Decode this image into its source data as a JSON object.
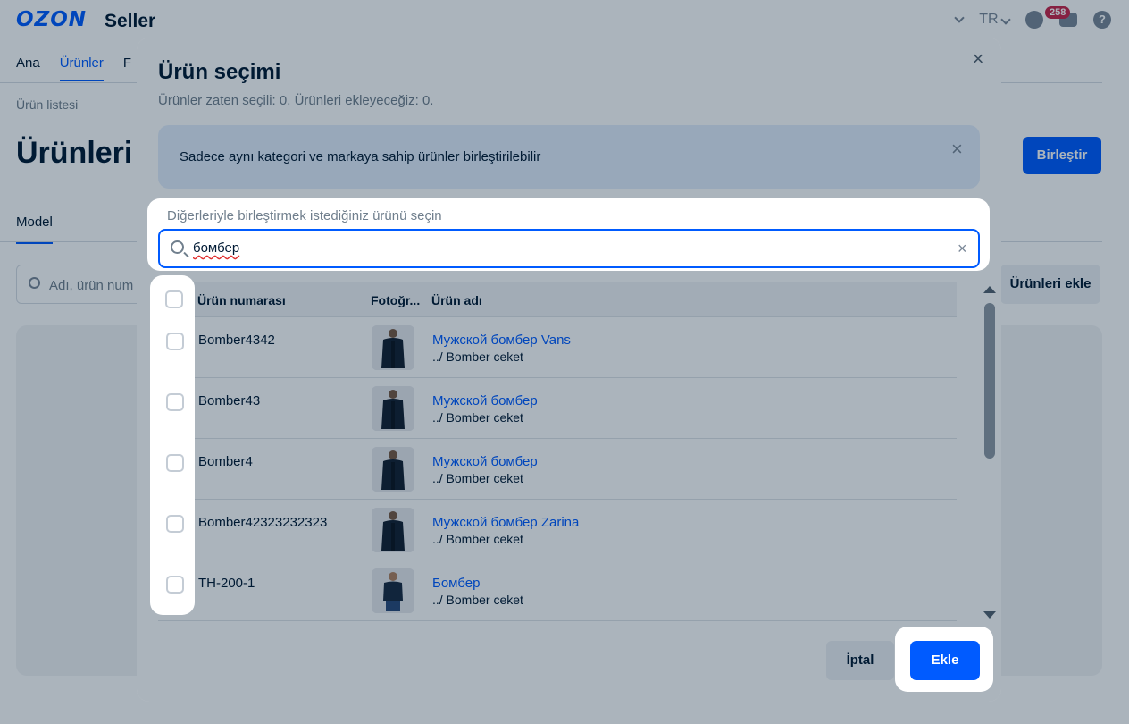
{
  "app": {
    "logo": "OZON",
    "logo_suffix": "Seller",
    "language": "TR",
    "notification_count": "258"
  },
  "nav": {
    "tabs": [
      {
        "label": "Ana"
      },
      {
        "label": "Ürünler"
      },
      {
        "label": "F"
      }
    ]
  },
  "page": {
    "breadcrumb": "Ürün listesi",
    "title": "Ürünleri b",
    "merge_button": "Birleştir",
    "model_tab": "Model",
    "search_placeholder": "Adı, ürün num",
    "add_products_button": "Ürünleri ekle"
  },
  "modal": {
    "title": "Ürün seçimi",
    "subtitle": "Ürünler zaten seçili: 0. Ürünleri ekleyeceğiz: 0.",
    "notice": "Sadece aynı kategori ve markaya sahip ürünler birleştirilebilir",
    "search_label": "Diğerleriyle birleştirmek istediğiniz ürünü seçin",
    "search_value": "бомбер",
    "columns": {
      "sku": "Ürün numarası",
      "photo": "Fotoğr...",
      "name": "Ürün adı"
    },
    "rows": [
      {
        "sku": "Bomber4342",
        "name": "Мужской бомбер Vans",
        "category": "../ Bomber ceket"
      },
      {
        "sku": "Bomber43",
        "name": "Мужской бомбер",
        "category": "../ Bomber ceket"
      },
      {
        "sku": "Bomber4",
        "name": "Мужской бомбер",
        "category": "../ Bomber ceket"
      },
      {
        "sku": "Bomber42323232323",
        "name": "Мужской бомбер Zarina",
        "category": "../ Bomber ceket"
      },
      {
        "sku": "TH-200-1",
        "name": "Бомбер",
        "category": "../ Bomber ceket"
      }
    ],
    "cancel_button": "İptal",
    "add_button": "Ekle"
  },
  "colors": {
    "accent": "#005bff",
    "badge": "#c8254a",
    "notice_bg": "#e3eefc"
  }
}
